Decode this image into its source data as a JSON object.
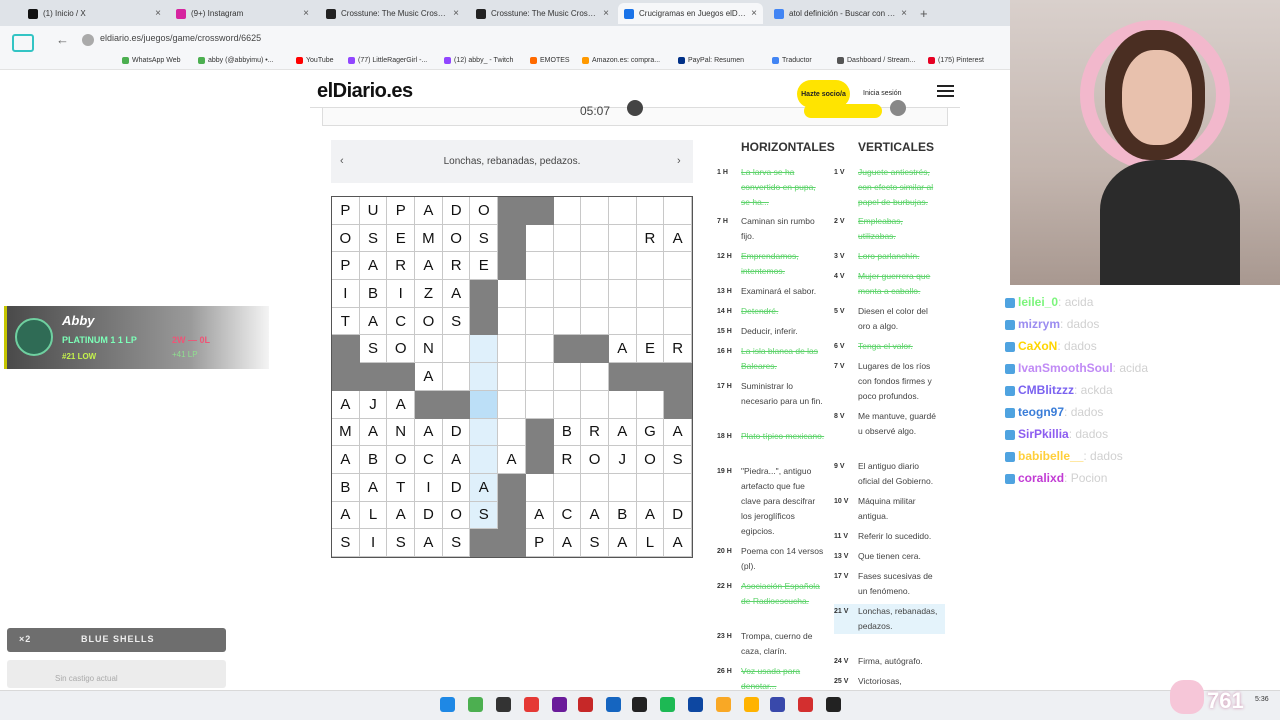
{
  "browser": {
    "tabs": [
      {
        "label": "(1) Inicio / X",
        "color": "#111111"
      },
      {
        "label": "(9+) Instagram",
        "color": "#d6249f"
      },
      {
        "label": "Crosstune: The Music Crosswo...",
        "color": "#222222"
      },
      {
        "label": "Crosstune: The Music Crosswo...",
        "color": "#222222"
      },
      {
        "label": "Crucigramas en Juegos elDiario...",
        "color": "#1a73e8"
      },
      {
        "label": "atol definición - Buscar con Go...",
        "color": "#4285f4"
      }
    ],
    "url": "eldiario.es/juegos/game/crossword/6625",
    "bookmarks": [
      "YouTube",
      "(77) LittleRagerGirl -...",
      "(12) abby_ - Twitch",
      "EMOTES",
      "Amazon.es: compra...",
      "PayPal: Resumen",
      "Traductor",
      "Dashboard / Stream...",
      "(175) Pinterest"
    ],
    "bookmarks_left": [
      "WhatsApp Web",
      "abby (@abbyimu) •..."
    ]
  },
  "site": {
    "logo": "elDiario.es",
    "subscribe": "Hazte socio/a",
    "login": "Inicia sesión",
    "timer": "05:07"
  },
  "crossword": {
    "current_clue": "Lonchas, rebanadas, pedazos.",
    "rows": [
      [
        "P",
        "U",
        "P",
        "A",
        "D",
        "O",
        "#",
        "#",
        "",
        "",
        "",
        "",
        ""
      ],
      [
        "O",
        "S",
        "E",
        "M",
        "O",
        "S",
        "#",
        "",
        "",
        "",
        "",
        "R",
        "A"
      ],
      [
        "P",
        "A",
        "R",
        "A",
        "R",
        "E",
        "#",
        "",
        "",
        "",
        "",
        "",
        ""
      ],
      [
        "I",
        "B",
        "I",
        "Z",
        "A",
        "#",
        "",
        "",
        "",
        "",
        "",
        "",
        ""
      ],
      [
        "T",
        "A",
        "C",
        "O",
        "S",
        "#",
        "",
        "",
        "",
        "",
        "",
        "",
        ""
      ],
      [
        "#",
        "S",
        "O",
        "N",
        "",
        "",
        "",
        "",
        "#",
        "#",
        "A",
        "E",
        "R",
        "R"
      ],
      [
        "#",
        "#",
        "#",
        "A",
        "",
        "",
        "",
        "",
        "",
        "",
        "#",
        "#",
        "#"
      ],
      [
        "A",
        "J",
        "A",
        "#",
        "#",
        "",
        "",
        "",
        "",
        "",
        "",
        "",
        "#"
      ],
      [
        "M",
        "A",
        "N",
        "A",
        "D",
        "",
        "",
        "#",
        "B",
        "R",
        "A",
        "G",
        "A"
      ],
      [
        "A",
        "B",
        "O",
        "C",
        "A",
        "",
        "A",
        "#",
        "R",
        "O",
        "J",
        "O",
        "S"
      ],
      [
        "B",
        "A",
        "T",
        "I",
        "D",
        "A",
        "#",
        "",
        "",
        "",
        "",
        "",
        ""
      ],
      [
        "A",
        "L",
        "A",
        "D",
        "O",
        "S",
        "#",
        "A",
        "C",
        "A",
        "B",
        "A",
        "D"
      ],
      [
        "S",
        "I",
        "S",
        "A",
        "S",
        "#",
        "#",
        "P",
        "A",
        "S",
        "A",
        "L",
        "A"
      ]
    ],
    "horizontales_title": "HORIZONTALES",
    "verticales_title": "VERTICALES",
    "horizontales": [
      {
        "num": "1 H",
        "text": "La larva se ha convertido en pupa, se ha...",
        "done": true
      },
      {
        "num": "7 H",
        "text": "Caminan sin rumbo fijo.",
        "done": false
      },
      {
        "num": "12 H",
        "text": "Emprendamos, intentemos.",
        "done": true
      },
      {
        "num": "13 H",
        "text": "Examinará el sabor.",
        "done": false
      },
      {
        "num": "14 H",
        "text": "Detendré.",
        "done": true
      },
      {
        "num": "15 H",
        "text": "Deducir, inferir.",
        "done": false
      },
      {
        "num": "16 H",
        "text": "La isla blanca de las Baleares.",
        "done": true
      },
      {
        "num": "17 H",
        "text": "Suministrar lo necesario para un fin.",
        "done": false
      },
      {
        "num": "18 H",
        "text": "Plato típico mexicano.",
        "done": true
      },
      {
        "num": "19 H",
        "text": "\"Piedra...\", antiguo artefacto que fue clave para descifrar los jeroglíficos egipcios.",
        "done": false
      },
      {
        "num": "20 H",
        "text": "Poema con 14 versos (pl).",
        "done": false
      },
      {
        "num": "22 H",
        "text": "Asociación Española de Radioescucha.",
        "done": true
      },
      {
        "num": "23 H",
        "text": "Trompa, cuerno de caza, clarín.",
        "done": false
      },
      {
        "num": "26 H",
        "text": "Voz usada para denotar...",
        "done": true
      }
    ],
    "verticales": [
      {
        "num": "1 V",
        "text": "Juguete antiestrés, con efecto similar al papel de burbujas.",
        "done": true
      },
      {
        "num": "2 V",
        "text": "Empleabas, utilizabas.",
        "done": true
      },
      {
        "num": "3 V",
        "text": "Loro parlanchín.",
        "done": true
      },
      {
        "num": "4 V",
        "text": "Mujer guerrera que monta a caballo.",
        "done": true
      },
      {
        "num": "5 V",
        "text": "Diesen el color del oro a algo.",
        "done": false
      },
      {
        "num": "6 V",
        "text": "Tenga el valor.",
        "done": true
      },
      {
        "num": "7 V",
        "text": "Lugares de los ríos con fondos firmes y poco profundos.",
        "done": false
      },
      {
        "num": "8 V",
        "text": "Me mantuve, guardé u observé algo.",
        "done": false
      },
      {
        "num": "9 V",
        "text": "El antiguo diario oficial del Gobierno.",
        "done": false
      },
      {
        "num": "10 V",
        "text": "Máquina militar antigua.",
        "done": false
      },
      {
        "num": "11 V",
        "text": "Referir lo sucedido.",
        "done": false
      },
      {
        "num": "13 V",
        "text": "Que tienen cera.",
        "done": false
      },
      {
        "num": "17 V",
        "text": "Fases sucesivas de un fenómeno.",
        "done": false
      },
      {
        "num": "21 V",
        "text": "Lonchas, rebanadas, pedazos.",
        "done": false
      },
      {
        "num": "24 V",
        "text": "Firma, autógrafo.",
        "done": false
      },
      {
        "num": "25 V",
        "text": "Victoriosas,",
        "done": false
      }
    ]
  },
  "overlay": {
    "lol_name": "Abby",
    "lol_rank": "PLATINUM 1 1 LP",
    "lol_ladder": "#21 LOW",
    "lol_record": "2W — 0L",
    "lol_delta": "+41 LP",
    "shells_count": "×2",
    "shells_label": "BLUE SHELLS",
    "shells_sub": "Sin castigo actual"
  },
  "chat": [
    {
      "user": "leilei_0",
      "msg": "acida",
      "color": "#7cf57c"
    },
    {
      "user": "mizrym",
      "msg": "dados",
      "color": "#9b8cf0"
    },
    {
      "user": "CaXoN",
      "msg": "dados",
      "color": "#ffd500"
    },
    {
      "user": "IvanSmoothSoul",
      "msg": "acida",
      "color": "#c08af5"
    },
    {
      "user": "CMBlitzzz",
      "msg": "ackda",
      "color": "#7a62f0"
    },
    {
      "user": "teogn97",
      "msg": "dados",
      "color": "#3a7dd8"
    },
    {
      "user": "SirPkillia",
      "msg": "dados",
      "color": "#8c5cf0"
    },
    {
      "user": "babibelle__",
      "msg": "dados",
      "color": "#ffcf3a"
    },
    {
      "user": "coralixd",
      "msg": "Pocion",
      "color": "#c23bd4"
    }
  ],
  "taskbar": {
    "viewers": "761",
    "time": "5:36"
  }
}
